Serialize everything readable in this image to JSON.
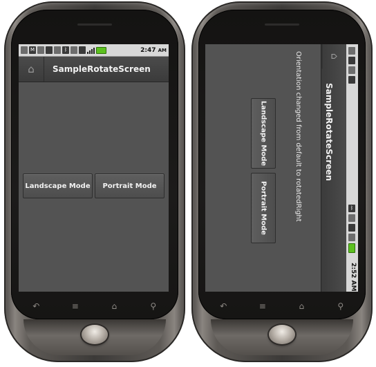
{
  "left": {
    "status_time": "2:47",
    "status_ampm": "AM",
    "title": "SampleRotateScreen",
    "buttons": {
      "landscape": "Landscape Mode",
      "portrait": "Portrait Mode"
    }
  },
  "right": {
    "status_time": "2:52 AM",
    "title": "SampleRotateScreen",
    "message": "Orientation changed from default to rotatedRight",
    "buttons": {
      "landscape": "Landscape Mode",
      "portrait": "Portrait Mode"
    }
  },
  "nav_keys": [
    "back-icon",
    "menu-icon",
    "home-icon",
    "search-icon"
  ],
  "colors": {
    "screen_bg": "#535353",
    "battery": "#5cc01f",
    "statusbar": "#d8d8d8"
  }
}
